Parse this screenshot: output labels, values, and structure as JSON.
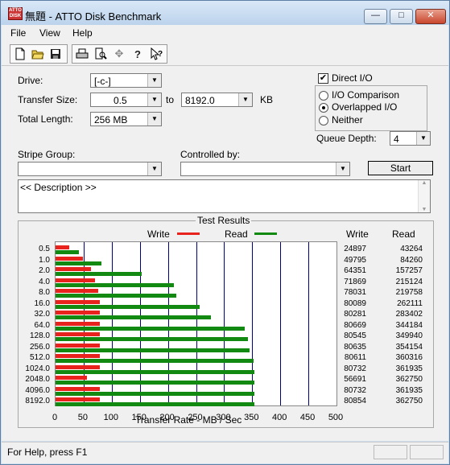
{
  "window": {
    "title": "無題 - ATTO Disk Benchmark",
    "icon_text": "ATTO DISK"
  },
  "title_buttons": {
    "minimize": "—",
    "maximize": "□",
    "close": "✕"
  },
  "menu": [
    "File",
    "View",
    "Help"
  ],
  "toolbar_icons": [
    "new-icon",
    "open-icon",
    "save-icon",
    "print-icon",
    "print-preview-icon",
    "move-icon",
    "help-icon",
    "context-help-icon"
  ],
  "form": {
    "drive_label": "Drive:",
    "drive_value": "[-c-]",
    "transfer_size_label": "Transfer Size:",
    "transfer_from": "0.5",
    "to_label": "to",
    "transfer_to": "8192.0",
    "kb_label": "KB",
    "total_length_label": "Total Length:",
    "total_length": "256 MB",
    "direct_io_label": "Direct I/O",
    "direct_io_checked": true,
    "io_comparison_label": "I/O Comparison",
    "overlapped_io_label": "Overlapped I/O",
    "neither_label": "Neither",
    "selected_mode": "Overlapped I/O",
    "queue_depth_label": "Queue Depth:",
    "queue_depth": "4",
    "stripe_group_label": "Stripe Group:",
    "stripe_group": "",
    "controlled_by_label": "Controlled by:",
    "controlled_by": "",
    "start_label": "Start",
    "description": "<< Description >>"
  },
  "results": {
    "group_label": "Test Results",
    "write_legend": "Write",
    "read_legend": "Read",
    "write_col": "Write",
    "read_col": "Read"
  },
  "chart_data": {
    "type": "bar",
    "orientation": "horizontal",
    "categories": [
      "0.5",
      "1.0",
      "2.0",
      "4.0",
      "8.0",
      "16.0",
      "32.0",
      "64.0",
      "128.0",
      "256.0",
      "512.0",
      "1024.0",
      "2048.0",
      "4096.0",
      "8192.0"
    ],
    "series": [
      {
        "name": "Write",
        "color": "#e8221c",
        "values": [
          24897,
          49795,
          64351,
          71869,
          78031,
          80089,
          80281,
          80669,
          80545,
          80635,
          80611,
          80732,
          56691,
          80732,
          80854
        ]
      },
      {
        "name": "Read",
        "color": "#128a12",
        "values": [
          43264,
          84260,
          157257,
          215124,
          219758,
          262111,
          283402,
          344184,
          349940,
          354154,
          360316,
          361935,
          362750,
          361935,
          362750
        ]
      }
    ],
    "xlabel": "Transfer Rate - MB / Sec",
    "xlim": [
      0,
      500
    ],
    "xticks": [
      "0",
      "50",
      "100",
      "150",
      "200",
      "250",
      "300",
      "350",
      "400",
      "450",
      "500"
    ],
    "value_unit_scale": 1024
  },
  "status": {
    "text": "For Help, press F1"
  }
}
